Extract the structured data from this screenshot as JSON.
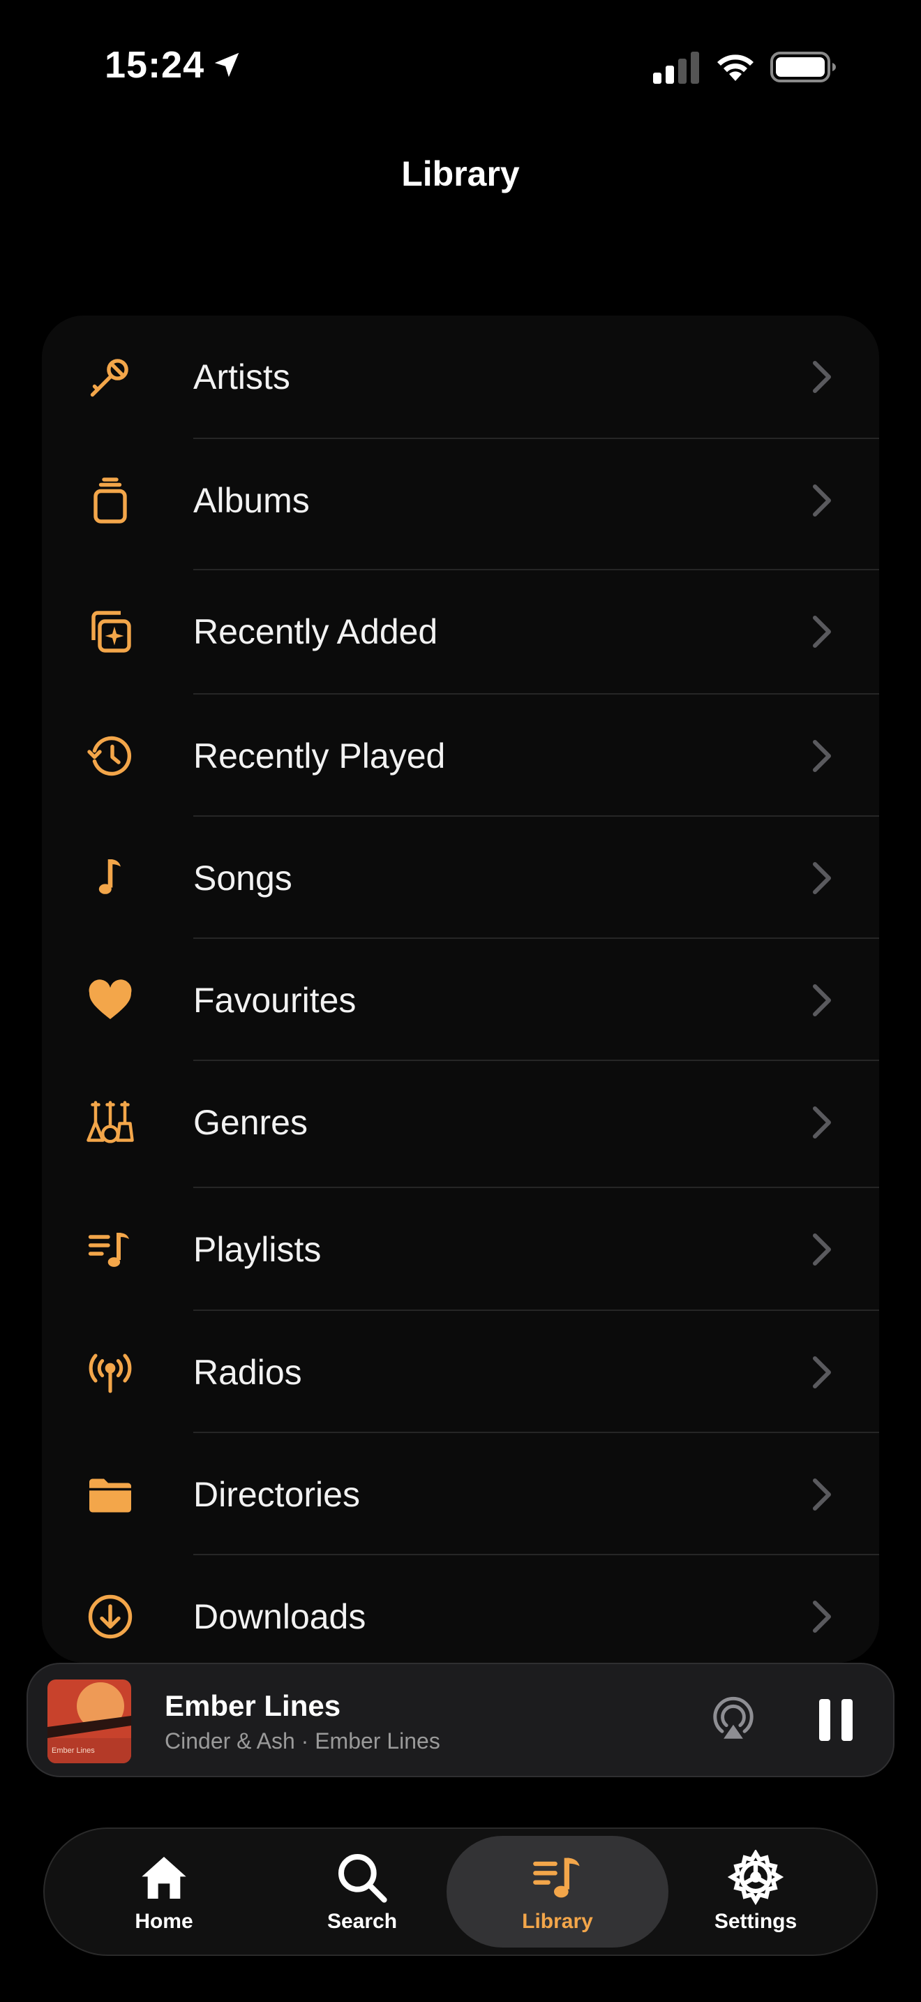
{
  "status_bar": {
    "time": "15:24"
  },
  "header": {
    "title": "Library"
  },
  "accent_color": "#f3a64a",
  "library_items": [
    {
      "label": "Artists",
      "icon": "microphone-icon"
    },
    {
      "label": "Albums",
      "icon": "album-stack-icon"
    },
    {
      "label": "Recently Added",
      "icon": "recently-added-icon"
    },
    {
      "label": "Recently Played",
      "icon": "history-clock-icon"
    },
    {
      "label": "Songs",
      "icon": "music-note-icon"
    },
    {
      "label": "Favourites",
      "icon": "heart-icon"
    },
    {
      "label": "Genres",
      "icon": "guitars-icon"
    },
    {
      "label": "Playlists",
      "icon": "playlist-icon"
    },
    {
      "label": "Radios",
      "icon": "radio-antenna-icon"
    },
    {
      "label": "Directories",
      "icon": "folder-icon"
    },
    {
      "label": "Downloads",
      "icon": "download-circle-icon"
    }
  ],
  "now_playing": {
    "title": "Ember Lines",
    "subtitle": "Cinder & Ash · Ember Lines",
    "art_caption": "Ember Lines",
    "is_playing": true
  },
  "tabs": [
    {
      "label": "Home",
      "icon": "home-icon"
    },
    {
      "label": "Search",
      "icon": "search-icon"
    },
    {
      "label": "Library",
      "icon": "library-icon",
      "active": true
    },
    {
      "label": "Settings",
      "icon": "settings-gear-icon"
    }
  ]
}
